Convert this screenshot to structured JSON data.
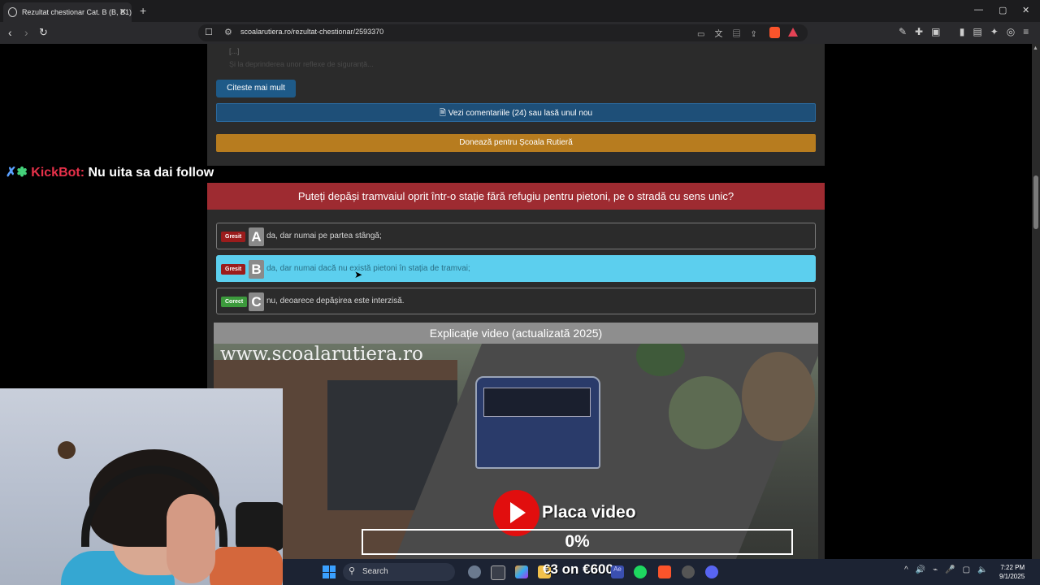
{
  "browser": {
    "tab_title": "Rezultat chestionar Cat. B (B, B1)",
    "tab_close": "✕",
    "new_tab": "+",
    "url": "scoalarutiera.ro/rezultat-chestionar/2593370",
    "window_controls": [
      "—",
      "▢",
      "✕"
    ]
  },
  "page": {
    "blurred_line1": "[...]",
    "blurred_line2": "Și la deprinderea unor reflexe de siguranță...",
    "read_more": "Citeste mai mult",
    "comments": "Vezi comentariile (24) sau lasă unul nou",
    "donate": "Donează pentru Școala Rutieră"
  },
  "chat_overlay": {
    "bot_name": "KickBot:",
    "message": "Nu uita sa dai follow"
  },
  "question": {
    "text": "Puteți depăși tramvaiul oprit într-o stație fără refugiu pentru pietoni, pe o stradă cu sens unic?",
    "answers": [
      {
        "status": "Gresit",
        "letter": "A",
        "text": "da, dar numai pe partea stângă;"
      },
      {
        "status": "Gresit",
        "letter": "B",
        "text": "da, dar numai dacă nu există pietoni în stația de tramvai;"
      },
      {
        "status": "Corect",
        "letter": "C",
        "text": "nu, deoarece depășirea este interzisă."
      }
    ]
  },
  "video": {
    "header": "Explicație video (actualizată 2025)",
    "watermark": "www.scoalarutiera.ro",
    "play_label": "Placa video",
    "progress_text": "0%",
    "progress": 0
  },
  "taskbar": {
    "search_label": "Search",
    "overlay_text": "€3 on €600",
    "time": "7:22 PM",
    "date": "9/1/2025"
  }
}
